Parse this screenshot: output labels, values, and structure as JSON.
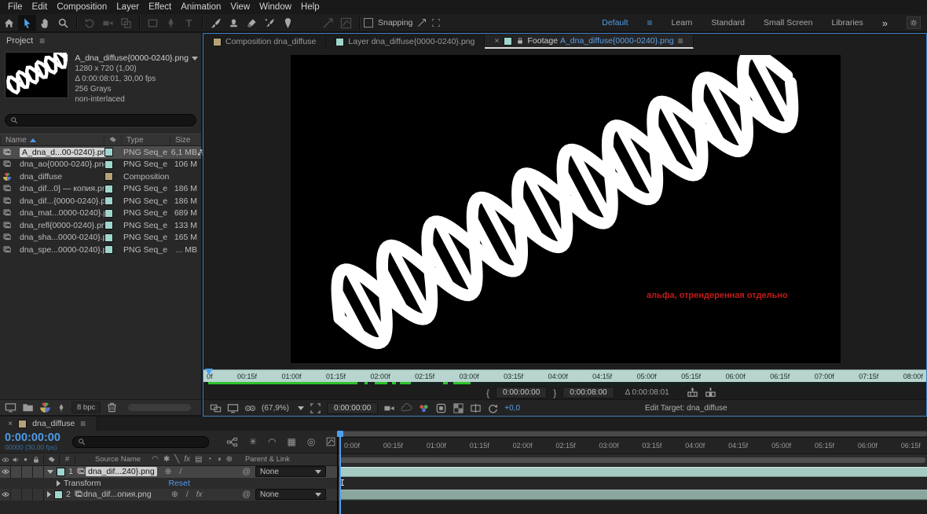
{
  "menu": {
    "items": [
      "File",
      "Edit",
      "Composition",
      "Layer",
      "Effect",
      "Animation",
      "View",
      "Window",
      "Help"
    ]
  },
  "toolbar": {
    "snapping_label": "Snapping",
    "workspaces": {
      "active": "Default",
      "items": [
        "Learn",
        "Standard",
        "Small Screen",
        "Libraries"
      ],
      "overflow": "»"
    }
  },
  "project": {
    "tab_label": "Project",
    "preview": {
      "title": "A_dna_diffuse{0000-0240}.png",
      "dimensions": "1280 x 720 (1,00)",
      "duration": "Δ 0:00:08:01, 30,00 fps",
      "depth": "256 Grays",
      "interlace": "non-interlaced"
    },
    "columns": {
      "name": "Name",
      "type": "Type",
      "size": "Size"
    },
    "rows": [
      {
        "name": "A_dna_d...00-0240}.png",
        "type": "PNG Seq_e",
        "size": "6,1 MB"
      },
      {
        "name": "dna_ao{0000-0240}.png",
        "type": "PNG Seq_e",
        "size": "106 M"
      },
      {
        "name": "dna_diffuse",
        "type": "Composition",
        "size": ""
      },
      {
        "name": "dna_dif...0] — копия.png",
        "type": "PNG Seq_e",
        "size": "186 M"
      },
      {
        "name": "dna_dif...{0000-0240}.png",
        "type": "PNG Seq_e",
        "size": "186 M"
      },
      {
        "name": "dna_mat...0000-0240}.png",
        "type": "PNG Seq_e",
        "size": "689 M"
      },
      {
        "name": "dna_refl{0000-0240}.png",
        "type": "PNG Seq_e",
        "size": "133 M"
      },
      {
        "name": "dna_sha...0000-0240}.png",
        "type": "PNG Seq_e",
        "size": "165 M"
      },
      {
        "name": "dna_spe...0000-0240}.png",
        "type": "PNG Seq_e",
        "size": "... MB"
      }
    ],
    "bpc_label": "8 bpc"
  },
  "viewer": {
    "tabs": [
      {
        "prefix": "Composition",
        "name": "dna_diffuse"
      },
      {
        "prefix": "Layer",
        "name": "dna_diffuse{0000-0240}.png"
      },
      {
        "prefix": "Footage",
        "name": "A_dna_diffuse{0000-0240}.png"
      }
    ],
    "annotation": "альфа, отрендеренная отдельно",
    "ruler_ticks": [
      "0f",
      "00:15f",
      "01:00f",
      "01:15f",
      "02:00f",
      "02:15f",
      "03:00f",
      "03:15f",
      "04:00f",
      "04:15f",
      "05:00f",
      "05:15f",
      "06:00f",
      "06:15f",
      "07:00f",
      "07:15f",
      "08:00f"
    ],
    "in_point": "0:00:00:00",
    "out_point": "0:00:08:00",
    "duration": "Δ 0:00:08:01",
    "zoom_level": "(67,9%)",
    "current_time": "0:00:00:00",
    "exposure": "+0,0",
    "edit_target": "Edit Target: dna_diffuse"
  },
  "timeline": {
    "tab_label": "dna_diffuse",
    "current_time": "0:00:00:00",
    "frame_info": "00000 (30,00 fps)",
    "columns": {
      "source": "Source Name",
      "parent": "Parent & Link",
      "number": "#"
    },
    "ruler_ticks": [
      "0:00f",
      "00:15f",
      "01:00f",
      "01:15f",
      "02:00f",
      "02:15f",
      "03:00f",
      "03:15f",
      "04:00f",
      "04:15f",
      "05:00f",
      "05:15f",
      "06:00f",
      "06:15f"
    ],
    "layers": [
      {
        "num": "1",
        "name": "dna_dif...240}.png",
        "parent": "None"
      },
      {
        "num": "2",
        "name": "dna_dif...опия.png",
        "parent": "None"
      }
    ],
    "transform_label": "Transform",
    "reset_label": "Reset",
    "fx_label": "fx",
    "quality_label": "/"
  }
}
